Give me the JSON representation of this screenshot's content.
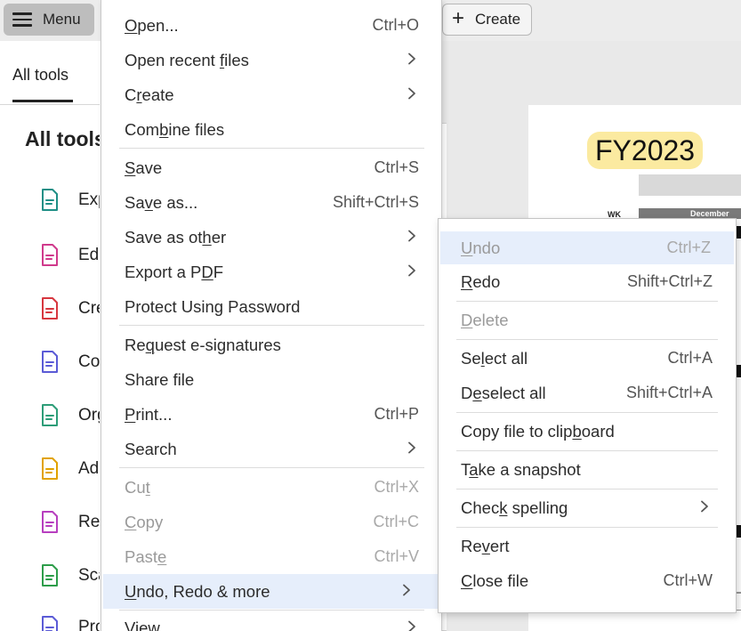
{
  "toolbar": {
    "menu_label": "Menu",
    "create_label": "Create"
  },
  "left_panel": {
    "tab_label": "All tools",
    "heading": "All tools",
    "tools": [
      {
        "label": "Exp",
        "icon": "export-pdf-icon",
        "color": "#1f8f86"
      },
      {
        "label": "Edi",
        "icon": "edit-pdf-icon",
        "color": "#d03a8c"
      },
      {
        "label": "Cre",
        "icon": "create-pdf-icon",
        "color": "#d7373f"
      },
      {
        "label": "Co",
        "icon": "combine-files-icon",
        "color": "#5b5bd6"
      },
      {
        "label": "Org",
        "icon": "organize-pages-icon",
        "color": "#2d9d78"
      },
      {
        "label": "Ad",
        "icon": "add-comment-icon",
        "color": "#e1a200"
      },
      {
        "label": "Re",
        "icon": "redact-icon",
        "color": "#b73fbf"
      },
      {
        "label": "Sca",
        "icon": "scan-ocr-icon",
        "color": "#2d9d4a"
      },
      {
        "label": "Pro",
        "icon": "protect-icon",
        "color": "#5b5bd6"
      }
    ]
  },
  "document": {
    "fy_label": "FY2023",
    "wk_label": "WK",
    "month_header": "December"
  },
  "menu": {
    "items": [
      {
        "pre": "",
        "key": "O",
        "post": "pen...",
        "shortcut": "Ctrl+O",
        "disabled": false
      },
      {
        "pre": "Open recent ",
        "key": "f",
        "post": "iles",
        "shortcut": "",
        "disabled": false
      },
      {
        "pre": "C",
        "key": "r",
        "post": "eate",
        "shortcut": "",
        "disabled": false
      },
      {
        "pre": "Com",
        "key": "b",
        "post": "ine files",
        "shortcut": "",
        "disabled": false
      },
      {
        "pre": "",
        "key": "S",
        "post": "ave",
        "shortcut": "Ctrl+S",
        "disabled": false
      },
      {
        "pre": "Sa",
        "key": "v",
        "post": "e as...",
        "shortcut": "Shift+Ctrl+S",
        "disabled": false
      },
      {
        "pre": "Save as ot",
        "key": "h",
        "post": "er",
        "shortcut": "",
        "disabled": false
      },
      {
        "pre": "Export a P",
        "key": "D",
        "post": "F",
        "shortcut": "",
        "disabled": false
      },
      {
        "pre": "Protect Using Password",
        "key": "",
        "post": "",
        "shortcut": "",
        "disabled": false
      },
      {
        "pre": "Re",
        "key": "q",
        "post": "uest e-signatures",
        "shortcut": "",
        "disabled": false
      },
      {
        "pre": "Share file",
        "key": "",
        "post": "",
        "shortcut": "",
        "disabled": false
      },
      {
        "pre": "",
        "key": "P",
        "post": "rint...",
        "shortcut": "Ctrl+P",
        "disabled": false
      },
      {
        "pre": "Search",
        "key": "",
        "post": "",
        "shortcut": "",
        "disabled": false
      },
      {
        "pre": "Cu",
        "key": "t",
        "post": "",
        "shortcut": "Ctrl+X",
        "disabled": true
      },
      {
        "pre": "",
        "key": "C",
        "post": "opy",
        "shortcut": "Ctrl+C",
        "disabled": true
      },
      {
        "pre": "Past",
        "key": "e",
        "post": "",
        "shortcut": "Ctrl+V",
        "disabled": true
      },
      {
        "pre": "",
        "key": "U",
        "post": "ndo, Redo & more",
        "shortcut": "",
        "disabled": false
      },
      {
        "pre": "",
        "key": "V",
        "post": "iew",
        "shortcut": "",
        "disabled": false
      }
    ]
  },
  "submenu": {
    "items": [
      {
        "pre": "",
        "key": "U",
        "post": "ndo",
        "shortcut": "Ctrl+Z",
        "disabled": true
      },
      {
        "pre": "",
        "key": "R",
        "post": "edo",
        "shortcut": "Shift+Ctrl+Z",
        "disabled": false
      },
      {
        "pre": "",
        "key": "D",
        "post": "elete",
        "shortcut": "",
        "disabled": true
      },
      {
        "pre": "Se",
        "key": "l",
        "post": "ect all",
        "shortcut": "Ctrl+A",
        "disabled": false
      },
      {
        "pre": "D",
        "key": "e",
        "post": "select all",
        "shortcut": "Shift+Ctrl+A",
        "disabled": false
      },
      {
        "pre": "Copy file to clip",
        "key": "b",
        "post": "oard",
        "shortcut": "",
        "disabled": false
      },
      {
        "pre": "T",
        "key": "a",
        "post": "ke a snapshot",
        "shortcut": "",
        "disabled": false
      },
      {
        "pre": "Chec",
        "key": "k",
        "post": " spelling",
        "shortcut": "",
        "disabled": false
      },
      {
        "pre": "Re",
        "key": "v",
        "post": "ert",
        "shortcut": "",
        "disabled": false
      },
      {
        "pre": "",
        "key": "C",
        "post": "lose file",
        "shortcut": "Ctrl+W",
        "disabled": false
      }
    ]
  }
}
